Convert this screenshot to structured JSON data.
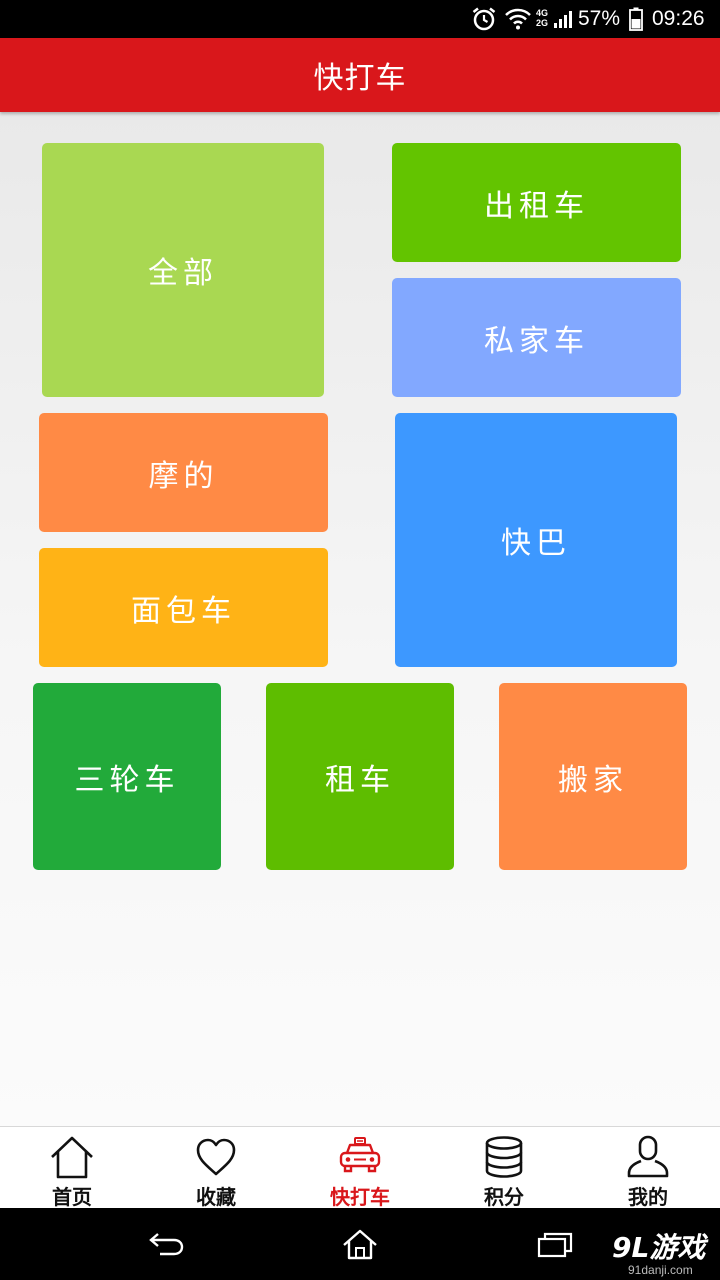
{
  "status_bar": {
    "network": "4G",
    "network2": "2G",
    "battery": "57%",
    "time": "09:26"
  },
  "header": {
    "title": "快打车"
  },
  "tiles": {
    "all": {
      "label": "全部",
      "color": "#a9d852"
    },
    "taxi": {
      "label": "出租车",
      "color": "#63c400"
    },
    "private": {
      "label": "私家车",
      "color": "#82a8ff"
    },
    "moto": {
      "label": "摩的",
      "color": "#ff8a45"
    },
    "bus": {
      "label": "快巴",
      "color": "#3d98ff"
    },
    "van": {
      "label": "面包车",
      "color": "#ffb316"
    },
    "tricycle": {
      "label": "三轮车",
      "color": "#22aa3a"
    },
    "rent": {
      "label": "租车",
      "color": "#5ebd00"
    },
    "moving": {
      "label": "搬家",
      "color": "#ff8a45"
    }
  },
  "tab_bar": {
    "tabs": [
      {
        "label": "首页",
        "icon": "home-icon"
      },
      {
        "label": "收藏",
        "icon": "heart-icon"
      },
      {
        "label": "快打车",
        "icon": "taxi-icon",
        "active": true
      },
      {
        "label": "积分",
        "icon": "database-icon"
      },
      {
        "label": "我的",
        "icon": "user-icon"
      }
    ],
    "active_color": "#d9171b"
  },
  "nav_bar": {
    "buttons": [
      "back-icon",
      "home-icon",
      "recents-icon"
    ]
  },
  "watermark": {
    "logo": "9L游戏",
    "url": "91danji.com"
  }
}
